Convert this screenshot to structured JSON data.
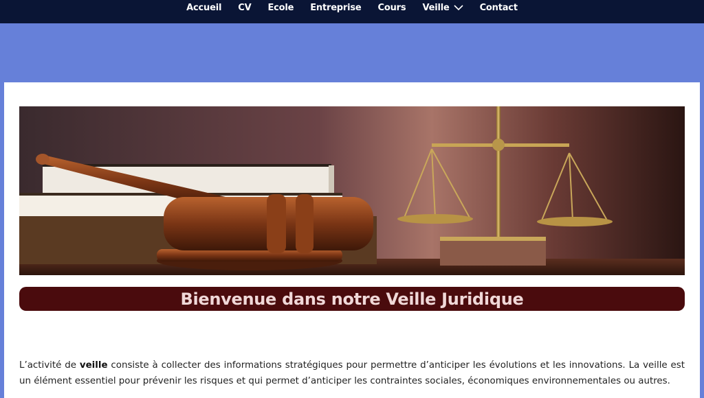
{
  "nav": {
    "items": [
      {
        "label": "Accueil"
      },
      {
        "label": "CV"
      },
      {
        "label": "Ecole"
      },
      {
        "label": "Entreprise"
      },
      {
        "label": "Cours"
      },
      {
        "label": "Veille",
        "has_dropdown": true
      },
      {
        "label": "Contact"
      }
    ]
  },
  "hero": {
    "image_desc": "gavel-books-scales-icon"
  },
  "banner": {
    "title": "Bienvenue dans notre Veille Juridique"
  },
  "intro": {
    "part1": "L’activité de ",
    "bold": "veille",
    "part2": " consiste à collecter des informations stratégiques pour permettre d’anticiper les évolutions et les innovations. La veille est un élément essentiel pour prévenir les risques et qui permet d’anticiper les contraintes sociales, économiques environnementales ou autres."
  },
  "colors": {
    "navbar_bg": "#0a1535",
    "page_bg": "#6680d9",
    "banner_bg": "#4a0b0d",
    "banner_text": "#f0d8d8"
  }
}
